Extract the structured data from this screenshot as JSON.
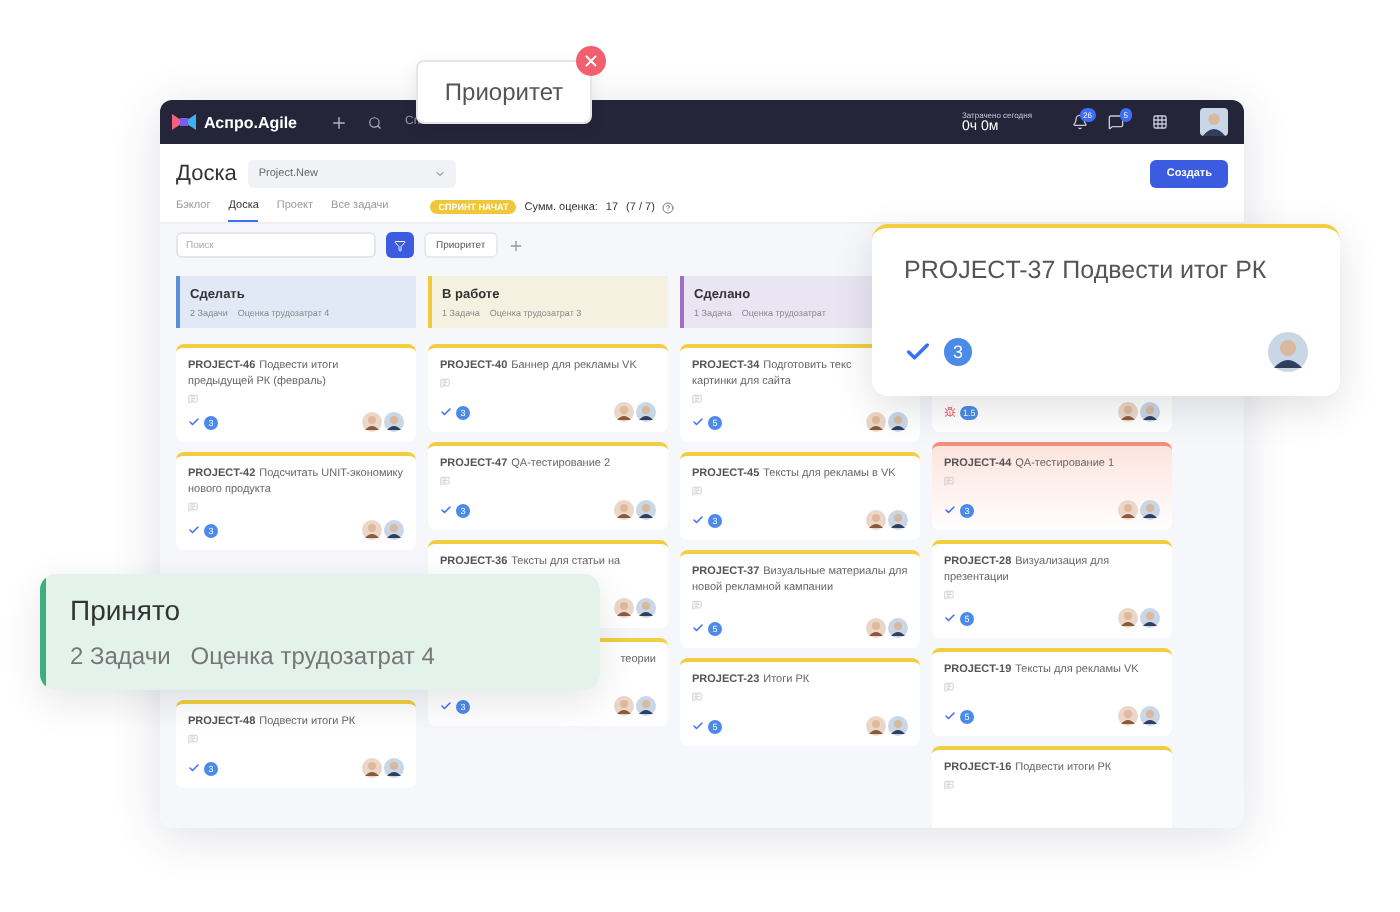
{
  "topbar": {
    "brand": "Аспро.Agile",
    "nav_text": "Сп",
    "time_label": "Затрачено сегодня",
    "time_value": "0ч 0м",
    "notifications": "26",
    "messages": "5"
  },
  "header": {
    "title": "Доска",
    "project": "Project.New",
    "create_button": "Создать"
  },
  "tabs": [
    {
      "label": "Бэклог",
      "selected": false
    },
    {
      "label": "Доска",
      "selected": true
    },
    {
      "label": "Проект",
      "selected": false
    },
    {
      "label": "Все задачи",
      "selected": false
    }
  ],
  "sprint": {
    "badge": "СПРИНТ НАЧАТ",
    "sum_label": "Сумм. оценка:",
    "sum_value": "17",
    "sum_ratio": "(7 / 7)"
  },
  "filters": {
    "search_placeholder": "Поиск",
    "chip": "Приоритет"
  },
  "columns": [
    {
      "title": "Сделать",
      "tasks": "2 Задачи",
      "estimate": "Оценка трудозатрат 4",
      "color": "#5b8fd6",
      "cards": [
        {
          "key": "PROJECT-46",
          "title": "Подвести итоги предыдущей РК (февраль)",
          "kind": "task",
          "overdue": false,
          "points": "3"
        },
        {
          "key": "PROJECT-42",
          "title": "Подсчитать UNIT-экономику нового продукта",
          "kind": "task",
          "overdue": false,
          "points": "3"
        },
        {
          "key": "PROJECT-48",
          "title": "Подвести итоги РК",
          "kind": "task",
          "overdue": false,
          "points": "3"
        }
      ]
    },
    {
      "title": "В работе",
      "tasks": "1 Задача",
      "estimate": "Оценка трудозатрат 3",
      "color": "#f0cc3c",
      "cards": [
        {
          "key": "PROJECT-40",
          "title": "Баннер для рекламы VK",
          "kind": "task",
          "overdue": false,
          "points": "3"
        },
        {
          "key": "PROJECT-47",
          "title": "QA-тестирование 2",
          "kind": "task",
          "overdue": false,
          "points": "3"
        },
        {
          "key": "PROJECT-36",
          "title": "Тексты для статьи на",
          "kind": "task",
          "overdue": false
        },
        {
          "title": "теории",
          "kind": "task",
          "overdue": false,
          "points": "3"
        }
      ]
    },
    {
      "title": "Сделано",
      "tasks": "1 Задача",
      "estimate": "Оценка трудозатрат",
      "color": "#9b6fc4",
      "cards": [
        {
          "key": "PROJECT-34",
          "title": "Подготовить текс\nкартинки для сайта",
          "kind": "task",
          "overdue": false,
          "points": "5"
        },
        {
          "key": "PROJECT-45",
          "title": "Тексты для рекламы в VK",
          "kind": "task",
          "overdue": false,
          "points": "3"
        },
        {
          "key": "PROJECT-37",
          "title": "Визуальные материалы для новой рекламной кампании",
          "kind": "task",
          "overdue": false,
          "points": "5"
        },
        {
          "key": "PROJECT-23",
          "title": "Итоги РК",
          "kind": "task",
          "overdue": false,
          "points": "5"
        }
      ]
    },
    {
      "cards": [
        {
          "kind": "bug",
          "overdue": false,
          "points": "1.5"
        },
        {
          "key": "PROJECT-44",
          "title": "QA-тестирование 1",
          "kind": "task",
          "overdue": true,
          "points": "3"
        },
        {
          "key": "PROJECT-28",
          "title": "Визуализация для презентации",
          "kind": "task",
          "overdue": false,
          "points": "5"
        },
        {
          "key": "PROJECT-19",
          "title": "Тексты для рекламы VK",
          "kind": "task",
          "overdue": false,
          "points": "5"
        },
        {
          "key": "PROJECT-16",
          "title": "Подвести итоги РК",
          "overdue": false
        }
      ]
    }
  ],
  "floating_chip": {
    "label": "Приоритет"
  },
  "dragged_card": {
    "title": "PROJECT-37 Подвести итог РК",
    "points": "3"
  },
  "dragged_column": {
    "title": "Принято",
    "tasks": "2 Задачи",
    "estimate": "Оценка трудозатрат 4",
    "color": "#3fae7e"
  }
}
